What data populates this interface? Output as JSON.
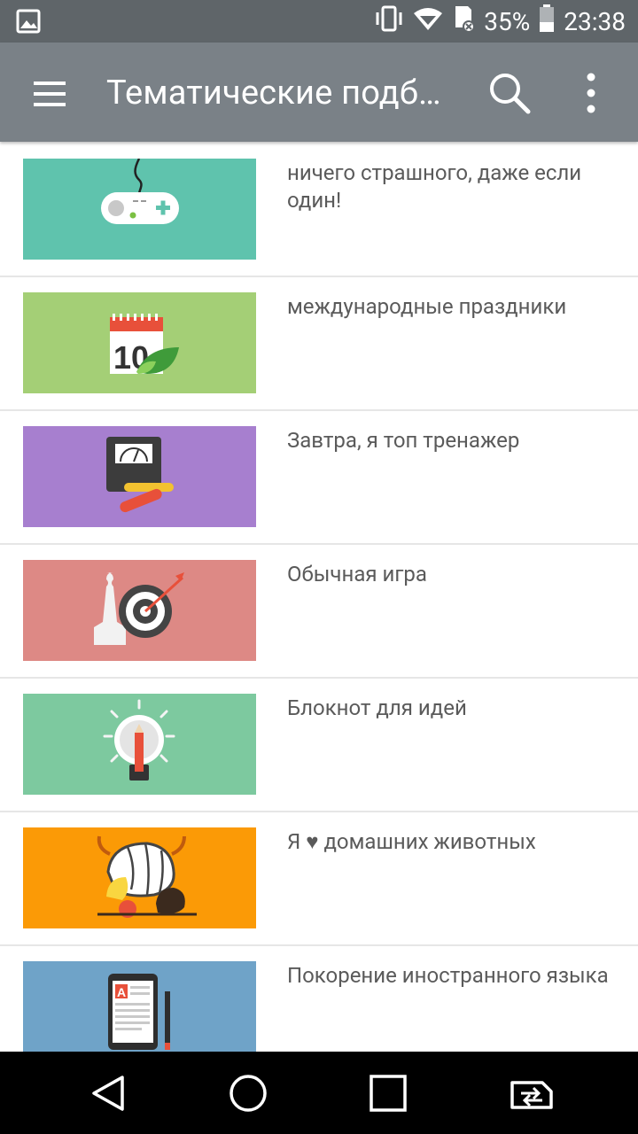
{
  "status": {
    "battery": "35%",
    "time": "23:38"
  },
  "appbar": {
    "title": "Тематические подб…"
  },
  "items": [
    {
      "label": "ничего страшного, даже если один!",
      "color": "#5fc3ad",
      "icon": "gamepad-icon"
    },
    {
      "label": "международные праздники",
      "color": "#a4cf76",
      "icon": "calendar-icon"
    },
    {
      "label": "Завтра, я топ тренажер",
      "color": "#a77fcf",
      "icon": "scale-dumbbell-icon"
    },
    {
      "label": "Обычная игра",
      "color": "#dd8985",
      "icon": "chess-target-icon"
    },
    {
      "label": "Блокнот для идей",
      "color": "#7dc99f",
      "icon": "lightbulb-pencil-icon"
    },
    {
      "label": "Я ♥ домашних животных",
      "color": "#fb9a06",
      "icon": "pets-icon"
    },
    {
      "label": "Покорение иностранного языка",
      "color": "#6fa3c8",
      "icon": "tablet-letter-icon"
    }
  ]
}
